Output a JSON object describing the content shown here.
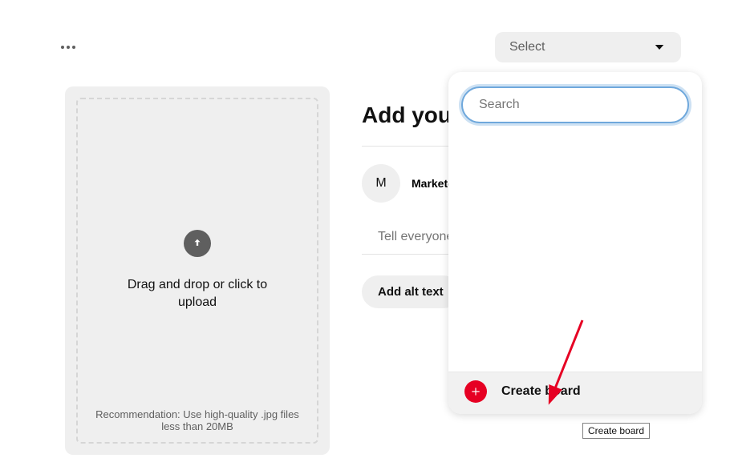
{
  "topbar": {
    "select_label": "Select"
  },
  "upload": {
    "main_text": "Drag and drop or click to upload",
    "reco_text": "Recommendation: Use high-quality .jpg files less than 20MB"
  },
  "form": {
    "title": "Add your title",
    "avatar_initial": "M",
    "username": "Marketdisc",
    "desc_placeholder": "Tell everyone what your Pin is about",
    "alt_button": "Add alt text"
  },
  "dropdown": {
    "search_placeholder": "Search",
    "create_label": "Create board",
    "tooltip": "Create board"
  }
}
